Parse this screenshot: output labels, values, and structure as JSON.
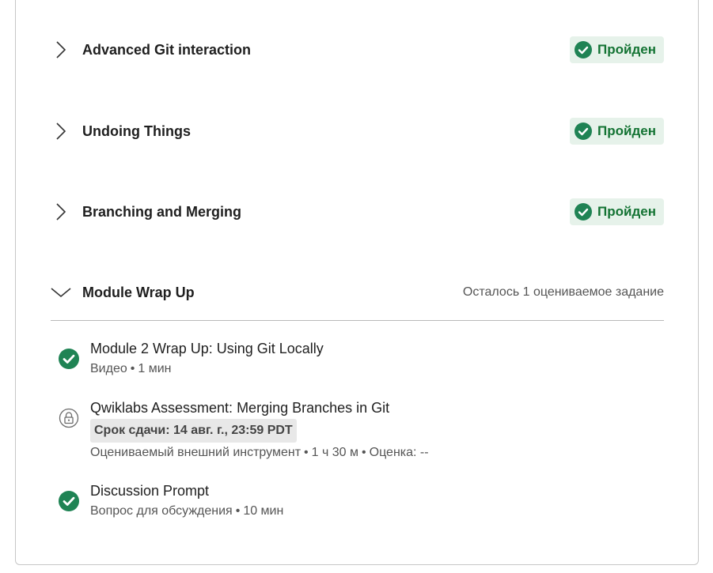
{
  "sections": [
    {
      "title": "Advanced Git interaction",
      "status": "Пройден"
    },
    {
      "title": "Undoing Things",
      "status": "Пройден"
    },
    {
      "title": "Branching and Merging",
      "status": "Пройден"
    },
    {
      "title": "Module Wrap Up",
      "remaining": "Осталось 1 оцениваемое задание"
    }
  ],
  "items": [
    {
      "title": "Module 2 Wrap Up: Using Git Locally",
      "type": "Видео",
      "duration": "1 мин"
    },
    {
      "title": "Qwiklabs Assessment: Merging Branches in Git",
      "deadline": "Срок сдачи: 14 авг. г., 23:59 PDT",
      "type": "Оцениваемый внешний инструмент",
      "duration": "1 ч 30 м",
      "grade": "Оценка: --"
    },
    {
      "title": "Discussion Prompt",
      "type": "Вопрос для обсуждения",
      "duration": "10 мин"
    }
  ],
  "colors": {
    "success": "#1f8354",
    "badge_bg": "#e6f2ea"
  }
}
